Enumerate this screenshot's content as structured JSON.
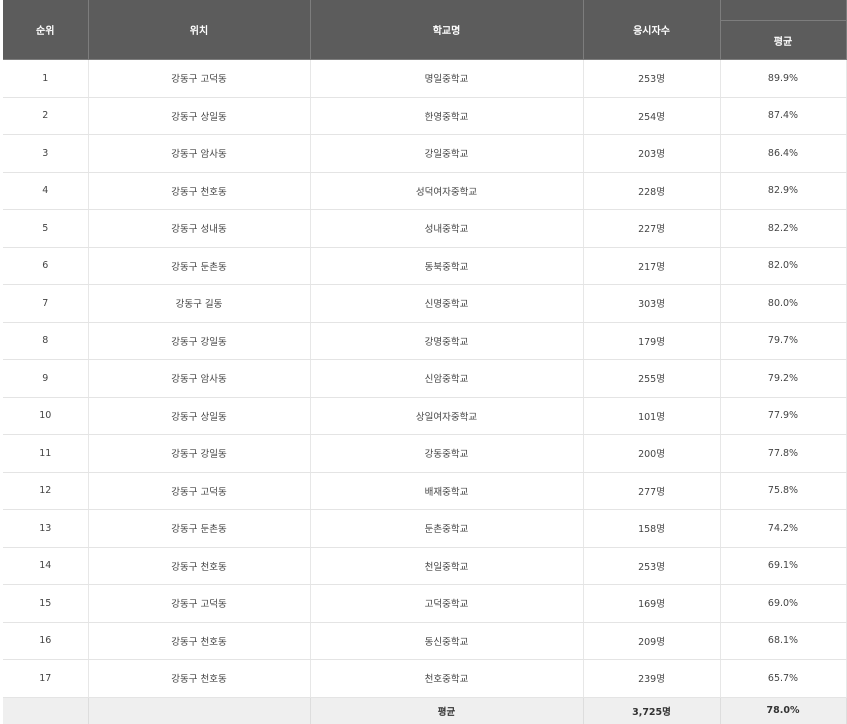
{
  "table": {
    "headers": {
      "rank": "순위",
      "location": "위치",
      "school": "학교명",
      "applicants": "응시자수",
      "average": "평균"
    },
    "rows": [
      {
        "rank": "1",
        "location": "강동구 고덕동",
        "school": "명일중학교",
        "applicants": "253명",
        "average": "89.9%"
      },
      {
        "rank": "2",
        "location": "강동구 상일동",
        "school": "한영중학교",
        "applicants": "254명",
        "average": "87.4%"
      },
      {
        "rank": "3",
        "location": "강동구 암사동",
        "school": "강일중학교",
        "applicants": "203명",
        "average": "86.4%"
      },
      {
        "rank": "4",
        "location": "강동구 천호동",
        "school": "성덕여자중학교",
        "applicants": "228명",
        "average": "82.9%"
      },
      {
        "rank": "5",
        "location": "강동구 성내동",
        "school": "성내중학교",
        "applicants": "227명",
        "average": "82.2%"
      },
      {
        "rank": "6",
        "location": "강동구 둔촌동",
        "school": "동북중학교",
        "applicants": "217명",
        "average": "82.0%"
      },
      {
        "rank": "7",
        "location": "강동구 길동",
        "school": "신명중학교",
        "applicants": "303명",
        "average": "80.0%"
      },
      {
        "rank": "8",
        "location": "강동구 강일동",
        "school": "강명중학교",
        "applicants": "179명",
        "average": "79.7%"
      },
      {
        "rank": "9",
        "location": "강동구 암사동",
        "school": "신암중학교",
        "applicants": "255명",
        "average": "79.2%"
      },
      {
        "rank": "10",
        "location": "강동구 상일동",
        "school": "상일여자중학교",
        "applicants": "101명",
        "average": "77.9%"
      },
      {
        "rank": "11",
        "location": "강동구 강일동",
        "school": "강동중학교",
        "applicants": "200명",
        "average": "77.8%"
      },
      {
        "rank": "12",
        "location": "강동구 고덕동",
        "school": "배재중학교",
        "applicants": "277명",
        "average": "75.8%"
      },
      {
        "rank": "13",
        "location": "강동구 둔촌동",
        "school": "둔촌중학교",
        "applicants": "158명",
        "average": "74.2%"
      },
      {
        "rank": "14",
        "location": "강동구 천호동",
        "school": "천일중학교",
        "applicants": "253명",
        "average": "69.1%"
      },
      {
        "rank": "15",
        "location": "강동구 고덕동",
        "school": "고덕중학교",
        "applicants": "169명",
        "average": "69.0%"
      },
      {
        "rank": "16",
        "location": "강동구 천호동",
        "school": "동신중학교",
        "applicants": "209명",
        "average": "68.1%"
      },
      {
        "rank": "17",
        "location": "강동구 천호동",
        "school": "천호중학교",
        "applicants": "239명",
        "average": "65.7%"
      }
    ],
    "footer": {
      "label": "평균",
      "applicants_total": "3,725명",
      "average": "78.0%"
    }
  }
}
